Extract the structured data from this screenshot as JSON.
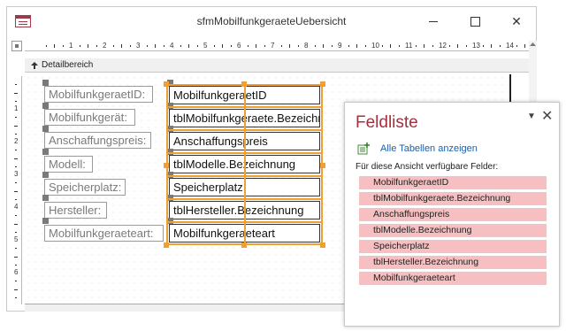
{
  "window": {
    "title": "sfmMobilfunkgeraeteUebersicht",
    "minimize_icon": "minimize-icon",
    "maximize_icon": "maximize-icon",
    "close_icon": "close-icon"
  },
  "ruler": {
    "horizontal": [
      "1",
      "2",
      "3",
      "4",
      "5",
      "6",
      "7",
      "8",
      "9",
      "10",
      "11",
      "12",
      "13",
      "14"
    ],
    "vertical": [
      "1",
      "2",
      "3",
      "4",
      "5",
      "6"
    ]
  },
  "section": {
    "label": "Detailbereich"
  },
  "controls": [
    {
      "label": "MobilfunkgeraetID:",
      "field": "MobilfunkgeraetID"
    },
    {
      "label": "Mobilfunkgerät:",
      "field": "tblMobilfunkgeraete.Bezeichnung"
    },
    {
      "label": "Anschaffungspreis:",
      "field": "Anschaffungspreis"
    },
    {
      "label": "Modell:",
      "field": "tblModelle.Bezeichnung"
    },
    {
      "label": "Speicherplatz:",
      "field": "Speicherplatz"
    },
    {
      "label": "Hersteller:",
      "field": "tblHersteller.Bezeichnung"
    },
    {
      "label": "Mobilfunkgeraeteart:",
      "field": "Mobilfunkgeraeteart"
    }
  ],
  "field_list": {
    "title": "Feldliste",
    "show_all_tables": "Alle Tabellen anzeigen",
    "available_heading": "Für diese Ansicht verfügbare Felder:",
    "fields": [
      "MobilfunkgeraetID",
      "tblMobilfunkgeraete.Bezeichnung",
      "Anschaffungspreis",
      "tblModelle.Bezeichnung",
      "Speicherplatz",
      "tblHersteller.Bezeichnung",
      "Mobilfunkgeraeteart"
    ]
  },
  "colors": {
    "accent": "#a3303e",
    "selection": "#f0a030",
    "field_highlight": "#f6c0c2",
    "link": "#1e5fa8"
  }
}
